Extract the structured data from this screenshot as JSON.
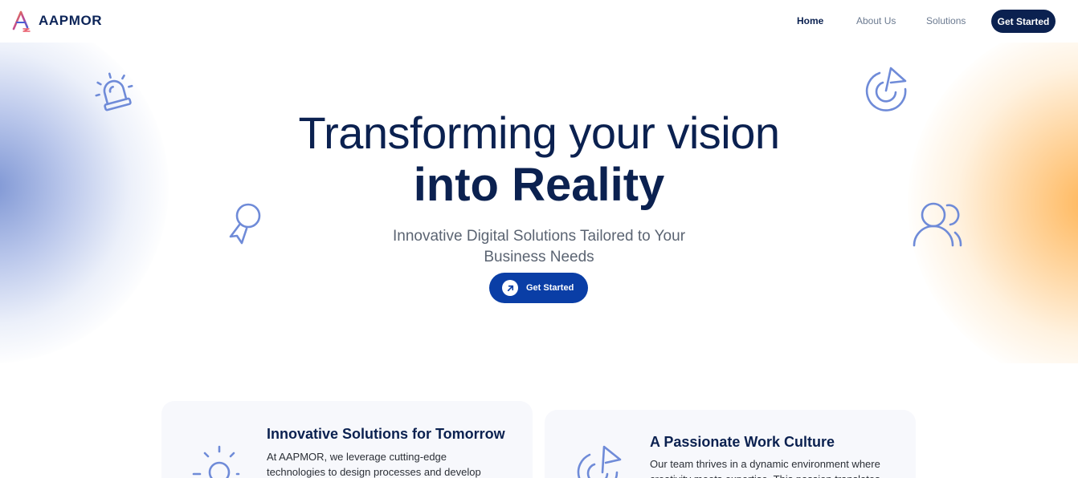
{
  "brand": {
    "name": "AAPMOR",
    "colors": {
      "navy": "#0b2150",
      "blue": "#0a3ea6",
      "icon_blue": "#6f8bd8",
      "orange_glow": "#ffb24f",
      "purple_glow": "#7891d2"
    }
  },
  "nav": {
    "links": [
      {
        "label": "Home",
        "active": true
      },
      {
        "label": "About Us",
        "active": false
      },
      {
        "label": "Solutions",
        "active": false
      }
    ],
    "cta_label": "Get Started"
  },
  "hero": {
    "title_line1": "Transforming your vision",
    "title_line2": "into Reality",
    "subtitle": "Innovative Digital Solutions Tailored to Your Business Needs",
    "cta_label": "Get Started",
    "decor_icons": [
      "siren-icon",
      "award-pin-icon",
      "target-flag-icon",
      "users-icon"
    ]
  },
  "cards": [
    {
      "title": "Innovative Solutions for Tomorrow",
      "description": "At AAPMOR, we leverage cutting-edge technologies to design processes and develop",
      "icon": "lightbulb-icon"
    },
    {
      "title": "A Passionate Work Culture",
      "description": "Our team thrives in a dynamic environment where creativity meets expertise. This passion translates",
      "icon": "target-flag-icon"
    }
  ]
}
